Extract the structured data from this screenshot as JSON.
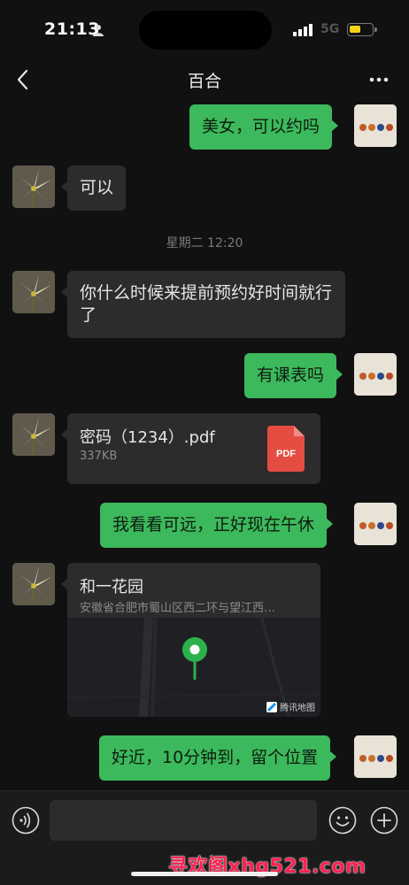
{
  "status_bar": {
    "time": "21:13",
    "network": "5G"
  },
  "header": {
    "title": "百合"
  },
  "messages": [
    {
      "side": "out",
      "text": "美女，可以约吗"
    },
    {
      "side": "in",
      "text": "可以"
    },
    {
      "type": "timestamp",
      "text": "星期二 12:20"
    },
    {
      "side": "in",
      "text": "你什么时候来提前预约好时间就行了"
    },
    {
      "side": "out",
      "text": "有课表吗"
    },
    {
      "side": "in",
      "type": "file",
      "name": "密码（1234）.pdf",
      "size": "337KB",
      "icon_label": "PDF"
    },
    {
      "side": "out",
      "text": "我看看可远，正好现在午休"
    },
    {
      "side": "in",
      "type": "location",
      "name": "和一花园",
      "address": "安徽省合肥市蜀山区西二环与望江西…",
      "map_attribution": "腾讯地图"
    },
    {
      "side": "out",
      "text": "好近，10分钟到，留个位置"
    }
  ],
  "input_bar": {
    "placeholder": ""
  },
  "watermark": "寻欢阁xhg521.com",
  "colors": {
    "outgoing_bubble": "#3cb95c",
    "incoming_bubble": "#2c2c2c",
    "background": "#111111",
    "pdf_red": "#e54d42",
    "pin_green": "#2bb24c"
  },
  "icons": [
    "back-arrow-icon",
    "more-dots-icon",
    "pdf-icon",
    "location-pin-icon",
    "voice-icon",
    "emoji-icon",
    "plus-icon"
  ]
}
